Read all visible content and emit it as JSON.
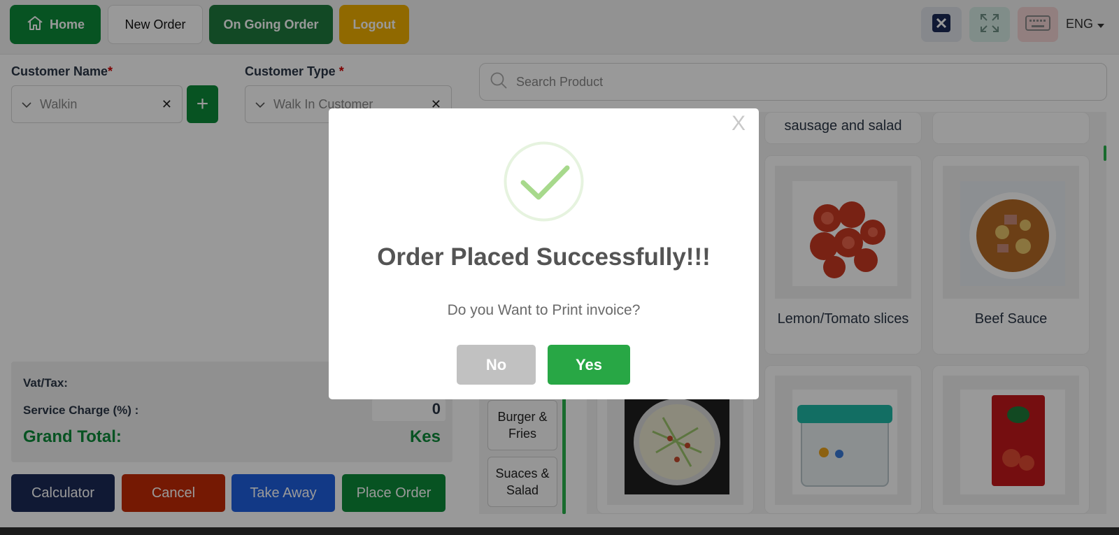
{
  "topbar": {
    "home_label": "Home",
    "new_order_label": "New Order",
    "ongoing_order_label": "On Going Order",
    "logout_label": "Logout",
    "language": "ENG"
  },
  "customer": {
    "name_label": "Customer Name",
    "name_required": "*",
    "name_value": "Walkin",
    "type_label": "Customer Type",
    "type_required": "*",
    "type_value": "Walk In Customer"
  },
  "totals": {
    "vat_label": "Vat/Tax:",
    "service_label": "Service Charge (%) :",
    "service_value": "0",
    "grand_label": "Grand Total:",
    "grand_value": "Kes"
  },
  "actions": {
    "calculator": "Calculator",
    "cancel": "Cancel",
    "take_away": "Take Away",
    "place_order": "Place Order"
  },
  "search": {
    "placeholder": "Search Product"
  },
  "categories": [
    "Burger &\nFries",
    "Suaces &\nSalad"
  ],
  "products": {
    "partial_top_line": "sausage and salad",
    "lemon": "Lemon/Tomato slices",
    "beef": "Beef Sauce"
  },
  "modal": {
    "close": "X",
    "title": "Order Placed Successfully!!!",
    "subtitle": "Do you Want to Print invoice?",
    "no": "No",
    "yes": "Yes"
  },
  "colors": {
    "brand_green": "#0d8a3a",
    "yes_green": "#28a745",
    "logout_amber": "#f1b000",
    "cancel_red": "#c42b05",
    "takeaway_blue": "#1f5fe0",
    "calc_navy": "#1c2b57"
  }
}
